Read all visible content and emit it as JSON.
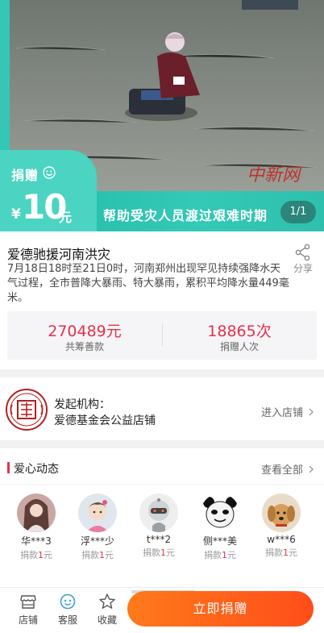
{
  "hero": {
    "donate_label": "捐赠",
    "amount_currency": "¥",
    "amount_value": "10",
    "amount_unit": "元",
    "slogan": "帮助受灾人员渡过艰难时期",
    "page_indicator": "1/1",
    "watermark": "中新网"
  },
  "project": {
    "title": "爱德驰援河南洪灾",
    "share_label": "分享",
    "description": "7月18日18时至21日0时，河南郑州出现罕见持续强降水天气过程，全市普降大暴雨、特大暴雨，累积平均降水量449毫米。"
  },
  "stats": {
    "raised_value": "270489元",
    "raised_label": "共筹善款",
    "donors_value": "18865次",
    "donors_label": "捐赠人次"
  },
  "organizer": {
    "line1": "发起机构：",
    "line2": "爱德基金会公益店铺",
    "enter_shop": "进入店铺",
    "logo_icon": "amity-seal-icon"
  },
  "feed": {
    "title": "爱心动态",
    "view_all": "查看全部",
    "donors": [
      {
        "name": "华***3",
        "amount_prefix": "捐款",
        "amount": "1",
        "amount_unit": "元",
        "avatar": "girl-portrait"
      },
      {
        "name": "浮***少",
        "amount_prefix": "捐款",
        "amount": "1",
        "amount_unit": "元",
        "avatar": "child-portrait"
      },
      {
        "name": "t***2",
        "amount_prefix": "捐款",
        "amount": "1",
        "amount_unit": "元",
        "avatar": "robot-cartoon"
      },
      {
        "name": "侧***美",
        "amount_prefix": "捐款",
        "amount": "1",
        "amount_unit": "元",
        "avatar": "panda-meme"
      },
      {
        "name": "w***6",
        "amount_prefix": "捐款",
        "amount": "1",
        "amount_unit": "元",
        "avatar": "dog-photo"
      }
    ]
  },
  "bottom": {
    "shop_label": "店铺",
    "service_label": "客服",
    "favorite_label": "收藏",
    "donate_now": "立即捐赠"
  },
  "colors": {
    "accent_red": "#e6304b",
    "teal": "#34c7b5",
    "cta_orange": "#ff5a1a"
  }
}
